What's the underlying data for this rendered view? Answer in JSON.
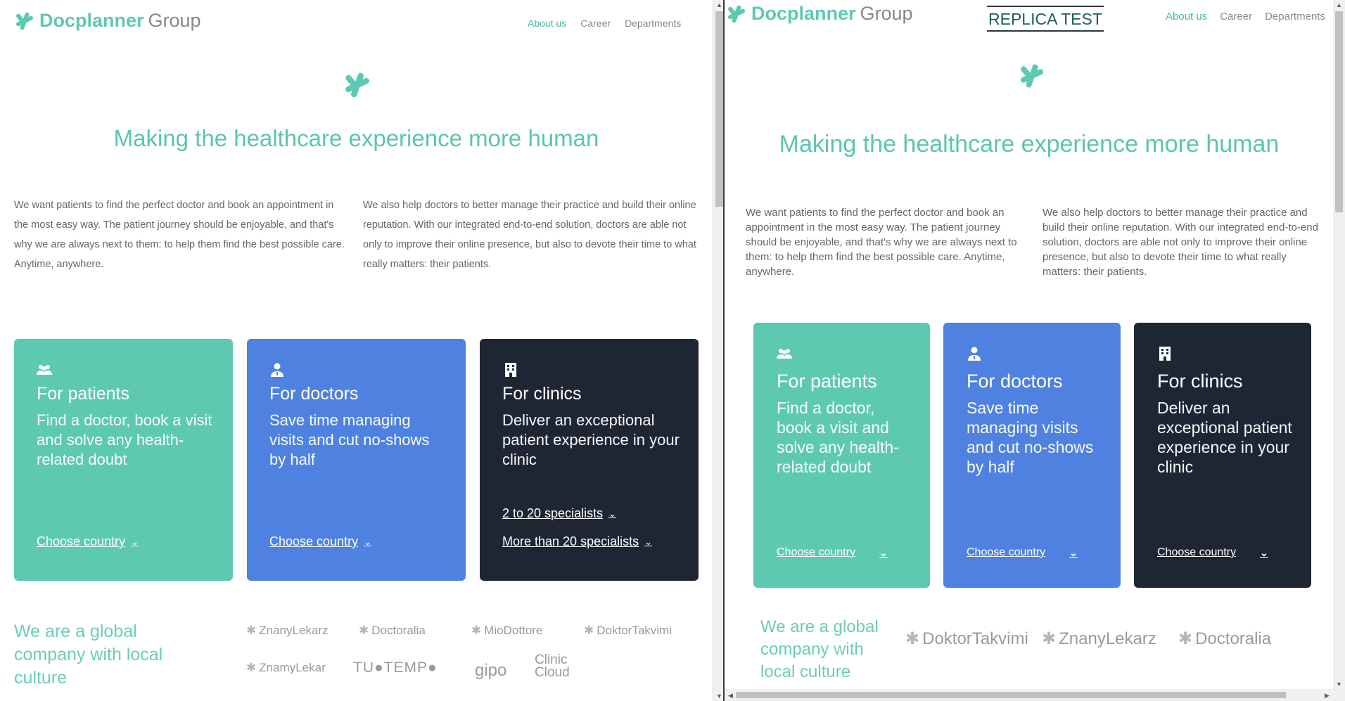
{
  "left": {
    "logo": {
      "brand": "Docplanner",
      "group": "Group"
    },
    "nav": [
      {
        "label": "About us",
        "active": true
      },
      {
        "label": "Career",
        "active": false
      },
      {
        "label": "Departments",
        "active": false
      }
    ],
    "hero_title": "Making the healthcare experience more human",
    "para1": "We want patients to find the perfect doctor and book an appointment in the most easy way. The patient journey should be enjoyable, and that's why we are always next to them: to help them find the best possible care. Anytime, anywhere.",
    "para2": "We also help doctors to better manage their practice and build their online reputation. With our integrated end-to-end solution, doctors are able not only to improve their online presence, but also to devote their time to what really matters: their patients.",
    "cards": [
      {
        "icon": "people-icon",
        "title": "For patients",
        "desc": "Find a doctor, book a visit and solve any health-related doubt",
        "links": [
          "Choose country"
        ]
      },
      {
        "icon": "doctor-icon",
        "title": "For doctors",
        "desc": "Save time managing visits and cut no-shows by half",
        "links": [
          "Choose country"
        ]
      },
      {
        "icon": "building-icon",
        "title": "For clinics",
        "desc": "Deliver an exceptional patient experience in your clinic",
        "links": [
          "2 to 20 specialists",
          "More than 20 specialists"
        ]
      }
    ],
    "tagline": "We are a global company with local culture",
    "brands": [
      "ZnanyLekarz",
      "Doctoralia",
      "MioDottore",
      "DoktorTakvimi",
      "ZnamyLekar",
      "TU●TEMP●",
      "gipo",
      "Clinic Cloud"
    ]
  },
  "right": {
    "logo": {
      "brand": "Docplanner",
      "group": "Group"
    },
    "replica_label": "REPLICA TEST",
    "nav": [
      {
        "label": "About us",
        "active": true
      },
      {
        "label": "Career",
        "active": false
      },
      {
        "label": "Departments",
        "active": false
      }
    ],
    "hero_title": "Making the healthcare experience more human",
    "para1": "We want patients to find the perfect doctor and book an appointment in the most easy way. The patient journey should be enjoyable, and that's why we are always next to them: to help them find the best possible care. Anytime, anywhere.",
    "para2": "We also help doctors to better manage their practice and build their online reputation. With our integrated end-to-end solution, doctors are able not only to improve their online presence, but also to devote their time to what really matters: their patients.",
    "cards": [
      {
        "icon": "people-icon",
        "title": "For patients",
        "desc": "Find a doctor, book a visit and solve any health-related doubt",
        "link": "Choose country"
      },
      {
        "icon": "doctor-icon",
        "title": "For doctors",
        "desc": "Save time managing visits and cut no-shows by half",
        "link": "Choose country"
      },
      {
        "icon": "building-icon",
        "title": "For clinics",
        "desc": "Deliver an exceptional patient experience in your clinic",
        "link": "Choose country"
      }
    ],
    "tagline": "We are a global company with local culture",
    "brands": [
      "DoktorTakvimi",
      "ZnanyLekarz",
      "Doctoralia"
    ]
  },
  "colors": {
    "teal": "#5ec9b1",
    "blue": "#4f82e0",
    "dark": "#1f2633",
    "accent_text": "#5ac6ad"
  }
}
